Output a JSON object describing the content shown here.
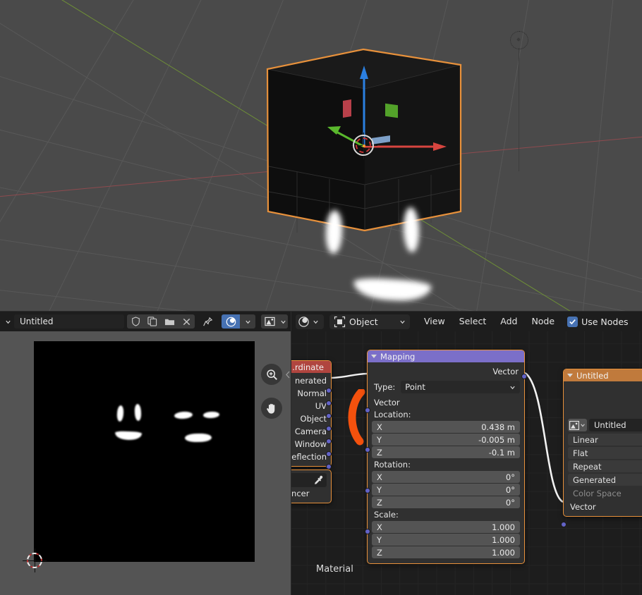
{
  "app": {
    "name": "Blender",
    "theme_bg": "#1d1d1d",
    "accent": "#4772b3"
  },
  "viewport": {
    "name": "3D Viewport",
    "background": "#4a4a4a",
    "object_outline_color": "#e8913b",
    "axis_x_color": "#8f4a4f",
    "axis_y_color": "#6e8f37",
    "gizmo": {
      "x_color": "#d7453f",
      "y_color": "#5ab82d",
      "z_color": "#2b7fe0"
    },
    "objects": [
      "cube",
      "light"
    ],
    "cursor": {
      "name": "3d-cursor"
    }
  },
  "image_editor": {
    "name": "Image Editor",
    "header": {
      "editor_type_icon": "image-editor-icon",
      "editor_type_chevron": "chevron-down-icon",
      "browse_image_icon": "browse-image-icon",
      "image_name": "Untitled",
      "fake_user_icon": "shield-icon",
      "new_image_icon": "copy-icon",
      "open_image_icon": "folder-icon",
      "unlink_icon": "x-icon",
      "pin_icon": "pin-icon",
      "mode_icon": "view-mode-icon",
      "mode_chevron": "chevron-down-icon",
      "display_channels_icon": "image-display-icon",
      "display_chevron": "chevron-down-icon"
    },
    "gizmos": {
      "zoom": "zoom-icon",
      "pan": "pan-hand-icon",
      "collapse": "chevron-left-icon"
    },
    "canvas": {
      "image_background": "#000000",
      "cursor": "2d-cursor"
    }
  },
  "node_editor": {
    "name": "Shader Editor",
    "header": {
      "editor_type_icon": "shader-editor-icon",
      "editor_type_chevron": "chevron-down-icon",
      "shader_type_icon": "object-icon",
      "shader_type": "Object",
      "shader_type_chevron": "chevron-down-icon",
      "menus": [
        "View",
        "Select",
        "Add",
        "Node"
      ],
      "use_nodes_label": "Use Nodes",
      "use_nodes_checked": true,
      "check_icon": "check-icon"
    },
    "breadcrumb": "Material",
    "nodes": [
      {
        "id": "texture-coordinate",
        "title": "...rdinate",
        "header_color": "#b0453f",
        "outputs": [
          "nerated",
          "Normal",
          "UV",
          "Object",
          "Camera",
          "Window",
          "eflection"
        ],
        "selected": true
      },
      {
        "id": "texture-coordinate-2",
        "title": "",
        "eyedropper_icon": "eyedropper-icon",
        "label": "ancer"
      },
      {
        "id": "mapping",
        "title": "Mapping",
        "header_color": "#7b6fc9",
        "collapse_icon": "triangle-down-icon",
        "output_socket": "Vector",
        "type_label": "Type:",
        "type_value": "Point",
        "type_chevron": "chevron-down-icon",
        "input_socket": "Vector",
        "groups": [
          {
            "label": "Location:",
            "rows": [
              {
                "axis": "X",
                "value": "0.438 m"
              },
              {
                "axis": "Y",
                "value": "-0.005 m"
              },
              {
                "axis": "Z",
                "value": "-0.1 m"
              }
            ]
          },
          {
            "label": "Rotation:",
            "rows": [
              {
                "axis": "X",
                "value": "0°"
              },
              {
                "axis": "Y",
                "value": "0°"
              },
              {
                "axis": "Z",
                "value": "0°"
              }
            ]
          },
          {
            "label": "Scale:",
            "rows": [
              {
                "axis": "X",
                "value": "1.000"
              },
              {
                "axis": "Y",
                "value": "1.000"
              },
              {
                "axis": "Z",
                "value": "1.000"
              }
            ]
          }
        ],
        "selected": true
      },
      {
        "id": "image-texture",
        "title": "Untitled",
        "header_color": "#c07a3c",
        "collapse_icon": "triangle-down-icon",
        "image_icon": "image-icon",
        "image_chevron": "chevron-down-icon",
        "image_name": "Untitled",
        "interpolation": "Linear",
        "projection": "Flat",
        "extension": "Repeat",
        "source": "Generated",
        "color_space_label": "Color Space",
        "input_socket": "Vector",
        "selected": true
      }
    ],
    "link_color": "#f2f2f2",
    "socket_color": "#6363c7"
  }
}
